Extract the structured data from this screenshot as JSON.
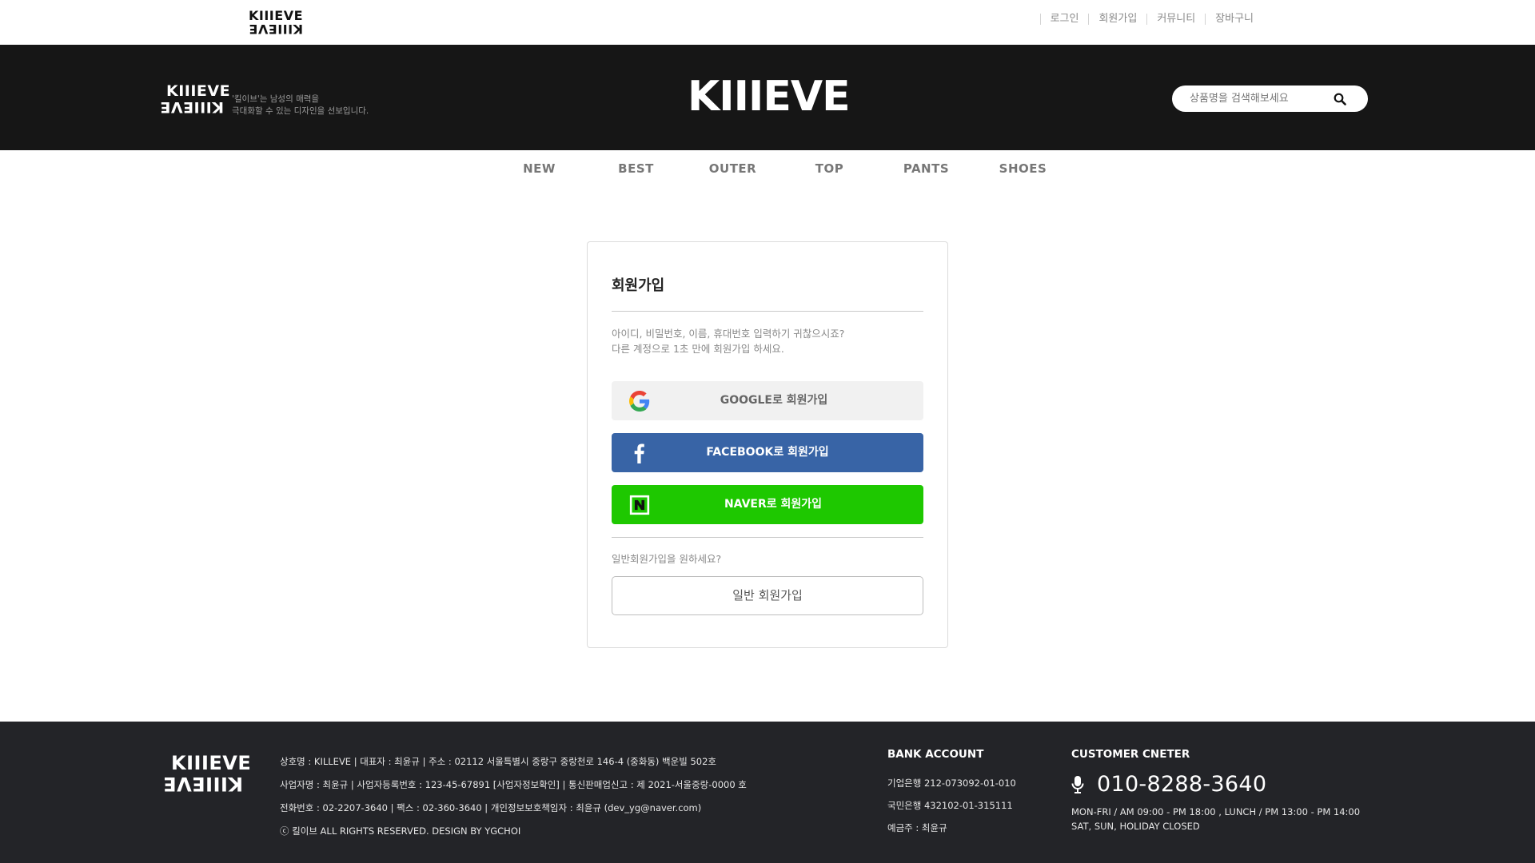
{
  "top_bar": {
    "logo_line1": "KIIIEVE",
    "logo_line2": "KIIIEVE",
    "links": [
      "로그인",
      "회원가입",
      "커뮤니티",
      "장바구니"
    ]
  },
  "header": {
    "brand_mark_line1": "KIIIEVE",
    "brand_mark_line2": "KIIIEVE",
    "tagline_line1": "'킬이브'는 남성의 매력을",
    "tagline_line2": "극대화할 수 있는 디자인을 선보입니다.",
    "main_logo": "KIIIEVE",
    "search": {
      "placeholder": "상품명을 검색해보세요",
      "icon": "search-icon"
    }
  },
  "category_nav": [
    "NEW",
    "BEST",
    "OUTER",
    "TOP",
    "PANTS",
    "SHOES"
  ],
  "signup": {
    "title": "회원가입",
    "description_line1": "아이디, 비밀번호, 이름, 휴대번호 입력하기 귀찮으시죠?",
    "description_line2": "다른 계정으로 1초 만에 회원가입 하세요.",
    "google_label": "GOOGLE로 회원가입",
    "facebook_label": "FACEBOOK로 회원가입",
    "naver_label": "NAVER로 회원가입",
    "general_question": "일반회원가입을 원하세요?",
    "general_button": "일반 회원가입"
  },
  "footer": {
    "logo_line1": "KIIIEVE",
    "logo_line2": "KIIIEVE",
    "info": [
      "상호명 : KILLEVE | 대표자 : 최윤규 | 주소 : 02112 서울특별시 중랑구 중랑천로 146-4 (중화동) 백운빌 502호",
      "사업자명 : 최윤규 | 사업자등록번호 : 123-45-67891 [사업자정보확인] | 통신판매업신고 : 제 2021-서울중랑-0000 호",
      "전화번호 : 02-2207-3640 | 팩스 : 02-360-3640 | 개인정보보호책임자 : 최윤규 (dev_yg@naver.com)",
      "ⓒ 킬이브 ALL RIGHTS RESERVED. DESIGN BY YGCHOI"
    ],
    "bank": {
      "heading": "BANK ACCOUNT",
      "lines": [
        "기업은행 212-073092-01-010",
        "국민은행 432102-01-315111",
        "예금주 : 최윤규"
      ]
    },
    "customer_center": {
      "heading": "CUSTOMER CNETER",
      "phone": "010-8288-3640",
      "hours_line1": "MON-FRI / AM 09:00 - PM 18:00 , LUNCH / PM 13:00 - PM 14:00",
      "hours_line2": "SAT, SUN, HOLIDAY CLOSED"
    }
  },
  "colors": {
    "header_bg": "#161616",
    "footer_bg": "#232428",
    "facebook": "#3864a6",
    "naver": "#1ec800",
    "google_btn": "#f1f1f1"
  }
}
